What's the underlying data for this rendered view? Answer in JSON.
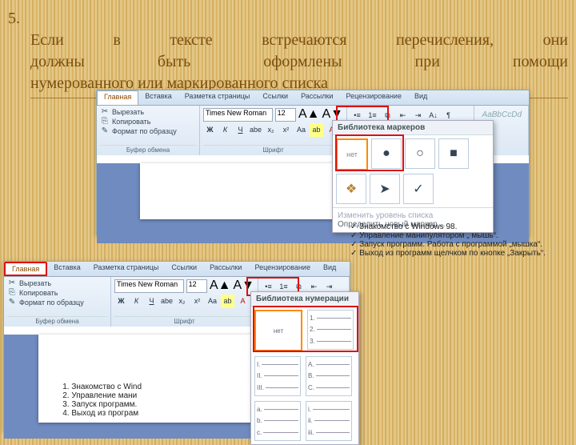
{
  "title": {
    "num": "5.",
    "line1": "Если в тексте встречаются перечисления, они",
    "line2": "должны быть оформлены при помощи",
    "line3": "нумерованного или маркированного списка"
  },
  "tabs": [
    "Главная",
    "Вставка",
    "Разметка страницы",
    "Ссылки",
    "Рассылки",
    "Рецензирование",
    "Вид"
  ],
  "active_tab": "Главная",
  "clipboard": {
    "cut": "Вырезать",
    "copy": "Копировать",
    "fmt": "Формат по образцу",
    "grp": "Буфер обмена"
  },
  "font": {
    "name": "Times New Roman",
    "size": "12",
    "grp": "Шрифт"
  },
  "bullets_dd": {
    "title": "Библиотека маркеров",
    "none": "нет",
    "change_level": "Изменить уровень списка",
    "define_new": "Определить новый маркер…",
    "glyphs": [
      "●",
      "○",
      "■",
      "❖",
      "➤",
      "✓"
    ]
  },
  "numbers_dd": {
    "title": "Библиотека нумерации",
    "none": "нет",
    "sets": [
      [
        "1.",
        "2.",
        "3."
      ],
      [
        "I.",
        "II.",
        "III."
      ],
      [
        "A.",
        "B.",
        "C."
      ],
      [
        "a.",
        "b.",
        "c."
      ],
      [
        "i.",
        "ii.",
        "iii."
      ]
    ]
  },
  "bullet_sample": [
    "✓ Знакомство с Windows 98.",
    "✓ Управление манипулятором „ мышь“.",
    "✓ Запуск программ. Работа с программой „мышка“.",
    "✓ Выход из программ щелчком по кнопке „Закрыть“."
  ],
  "number_sample": [
    "1.  Знакомство с Wind",
    "2.  Управление мани",
    "3.  Запуск программ.",
    "4.  Выход из програм"
  ]
}
